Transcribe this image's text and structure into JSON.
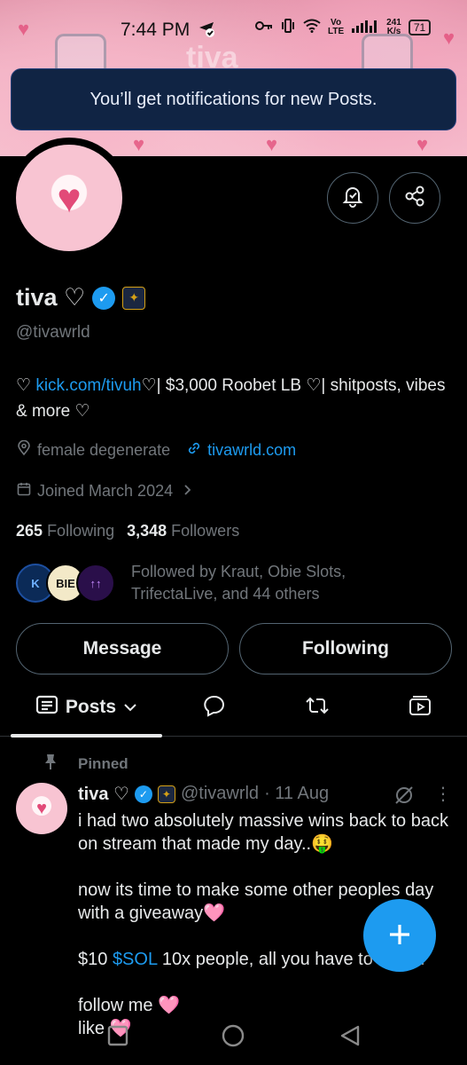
{
  "status_bar": {
    "time": "7:44 PM",
    "net_top": "241",
    "net_bottom": "K/s",
    "volte_top": "Vo",
    "volte_bottom": "LTE",
    "battery": "71"
  },
  "banner": {
    "text": "tiva"
  },
  "toast": {
    "message": "You’ll get notifications for new Posts."
  },
  "profile": {
    "name": "tiva ♡",
    "handle": "@tivawrld",
    "bio_prefix": "♡ ",
    "bio_link": "kick.com/tivuh",
    "bio_suffix": "♡| $3,000 Roobet LB ♡| shitposts, vibes & more ♡",
    "location": "female degenerate",
    "website": "tivawrld.com",
    "joined": "Joined March 2024",
    "following_count": "265",
    "following_label": "Following",
    "followers_count": "3,348",
    "followers_label": "Followers",
    "followed_by": "Followed by Kraut, Obie Slots, TrifectaLive, and 44 others",
    "followed_avatars": [
      "K",
      "BIE",
      "↑↑"
    ]
  },
  "buttons": {
    "message": "Message",
    "following": "Following"
  },
  "tabs": {
    "posts": "Posts"
  },
  "post": {
    "pinned_label": "Pinned",
    "author_name": "tiva ♡",
    "author_handle": "@tivawrld",
    "date": "· 11 Aug",
    "line1": "i had two absolutely massive wins back to back on stream that made my day..🤑",
    "line2": "now its time to make some other peoples day with a giveaway🩷",
    "line3_prefix": "$10 ",
    "line3_cashtag": "$SOL",
    "line3_suffix": " 10x people, all you have to do is..",
    "line4": "follow me 🩷",
    "line5": "like 🩷"
  },
  "colors": {
    "accent": "#1d9bf0",
    "background": "#000000",
    "muted": "#71767b",
    "toast_bg": "#102444"
  }
}
